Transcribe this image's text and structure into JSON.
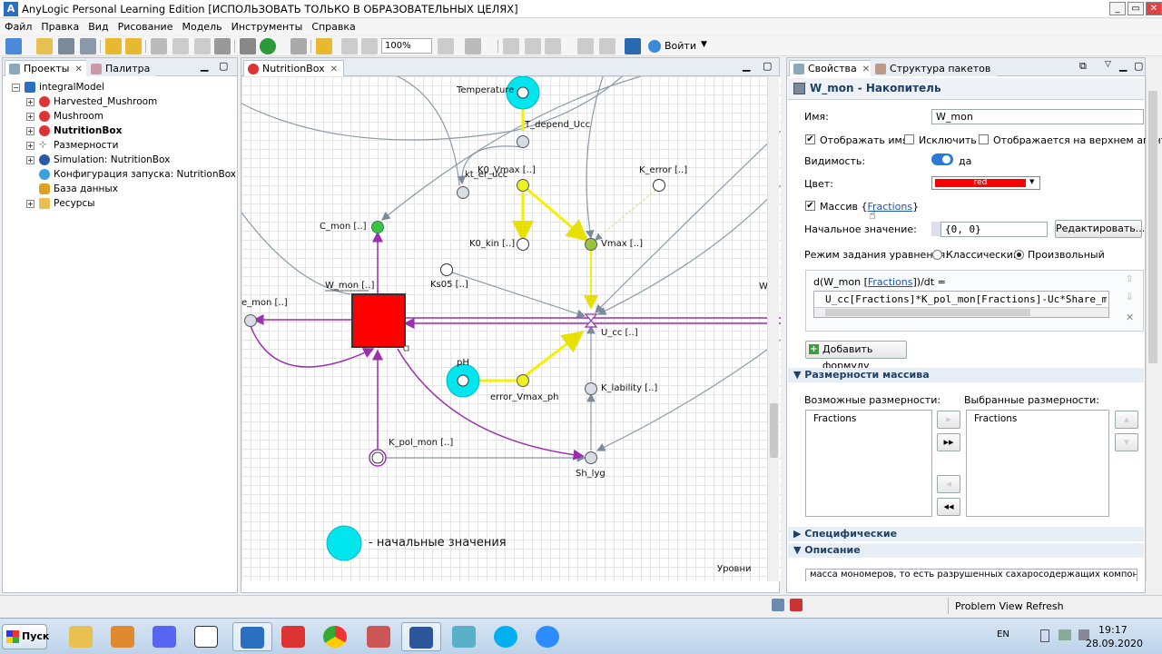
{
  "window": {
    "title": "AnyLogic Personal Learning Edition [ИСПОЛЬЗОВАТЬ ТОЛЬКО В ОБРАЗОВАТЕЛЬНЫХ ЦЕЛЯХ]",
    "min": "_",
    "max": "▭",
    "close": "✕"
  },
  "menu": [
    "Файл",
    "Правка",
    "Вид",
    "Рисование",
    "Модель",
    "Инструменты",
    "Справка"
  ],
  "toolbar": {
    "zoom": "100%",
    "login": "Войти"
  },
  "left": {
    "tabs": {
      "projects": "Проекты",
      "palette": "Палитра"
    },
    "tree": [
      {
        "label": "integralModel",
        "bold": false
      },
      {
        "label": "Harvested_Mushroom",
        "bold": false
      },
      {
        "label": "Mushroom",
        "bold": false
      },
      {
        "label": "NutritionBox",
        "bold": true
      },
      {
        "label": "Размерности",
        "bold": false
      },
      {
        "label": "Simulation: NutritionBox",
        "bold": false
      },
      {
        "label": "Конфигурация запуска: NutritionBox",
        "bold": false
      },
      {
        "label": "База данных",
        "bold": false
      },
      {
        "label": "Ресурсы",
        "bold": false
      }
    ]
  },
  "editor": {
    "tab": "NutritionBox",
    "labels": {
      "temperature": "Temperature",
      "t_depend": "T_depend_Ucc",
      "kt_er": "kt_er_ucc",
      "k0_vmax": "K0_Vmax [..]",
      "k_error": "K_error [..]",
      "c_mon": "C_mon [..]",
      "k0_kin": "K0_kin [..]",
      "vmax": "Vmax [..]",
      "ks05": "Ks05 [..]",
      "w_mon": "W_mon [..]",
      "e_mon": "e_mon [..]",
      "w_right": "W",
      "u_cc": "U_cc [..]",
      "ph": "pH",
      "error_vmax": "error_Vmax_ph",
      "k_lability": "K_lability [..]",
      "k_pol_mon": "K_pol_mon [..]",
      "sh_lyg": "Sh_lyg",
      "legend": "- начальные значения",
      "levels": "Уровни"
    }
  },
  "props": {
    "tabs": {
      "properties": "Свойства",
      "packages": "Структура пакетов"
    },
    "header": "W_mon - Накопитель",
    "name_label": "Имя:",
    "name_value": "W_mon",
    "show_name": "Отображать имя",
    "exclude": "Исключить",
    "show_top": "Отображается на верхнем агенте",
    "visibility_label": "Видимость:",
    "visibility_value": "да",
    "color_label": "Цвет:",
    "color_value": "red",
    "array_label": "Массив",
    "array_open": "{",
    "array_link": "Fractions",
    "array_close": "}",
    "initial_label": "Начальное значение:",
    "initial_value": "{0, 0}",
    "edit_button": "Редактировать...",
    "eq_mode_label": "Режим задания уравнения:",
    "eq_classic": "Классический",
    "eq_custom": "Произвольный",
    "formula_prefix": "d(W_mon [",
    "formula_link": "Fractions",
    "formula_suffix": "])/dt =",
    "formula_text": "U_cc[Fractions]*K_pol_mon[Fractions]-Uc*Share_mo",
    "add_formula": "Добавить формулу",
    "sec_dims": "Размерности массива",
    "possible_dims": "Возможные размерности:",
    "chosen_dims": "Выбранные размерности:",
    "possible_item": "Fractions",
    "chosen_item": "Fractions",
    "sec_specific": "Специфические",
    "sec_description": "Описание",
    "description_text": "масса мономеров, то есть разрушенных сахаросодержащих компонент"
  },
  "status": {
    "refresh": "Problem View Refresh"
  },
  "taskbar": {
    "start": "Пуск",
    "lang": "EN",
    "time": "19:17",
    "date": "28.09.2020"
  },
  "colors": {
    "stock": "#ff0000",
    "flow_main": "#9b2fae",
    "yellow_link": "#f5f000",
    "init_value": "#00e5ee",
    "aux_green": "#3dc43d",
    "aux_yellow": "#f0f020"
  }
}
